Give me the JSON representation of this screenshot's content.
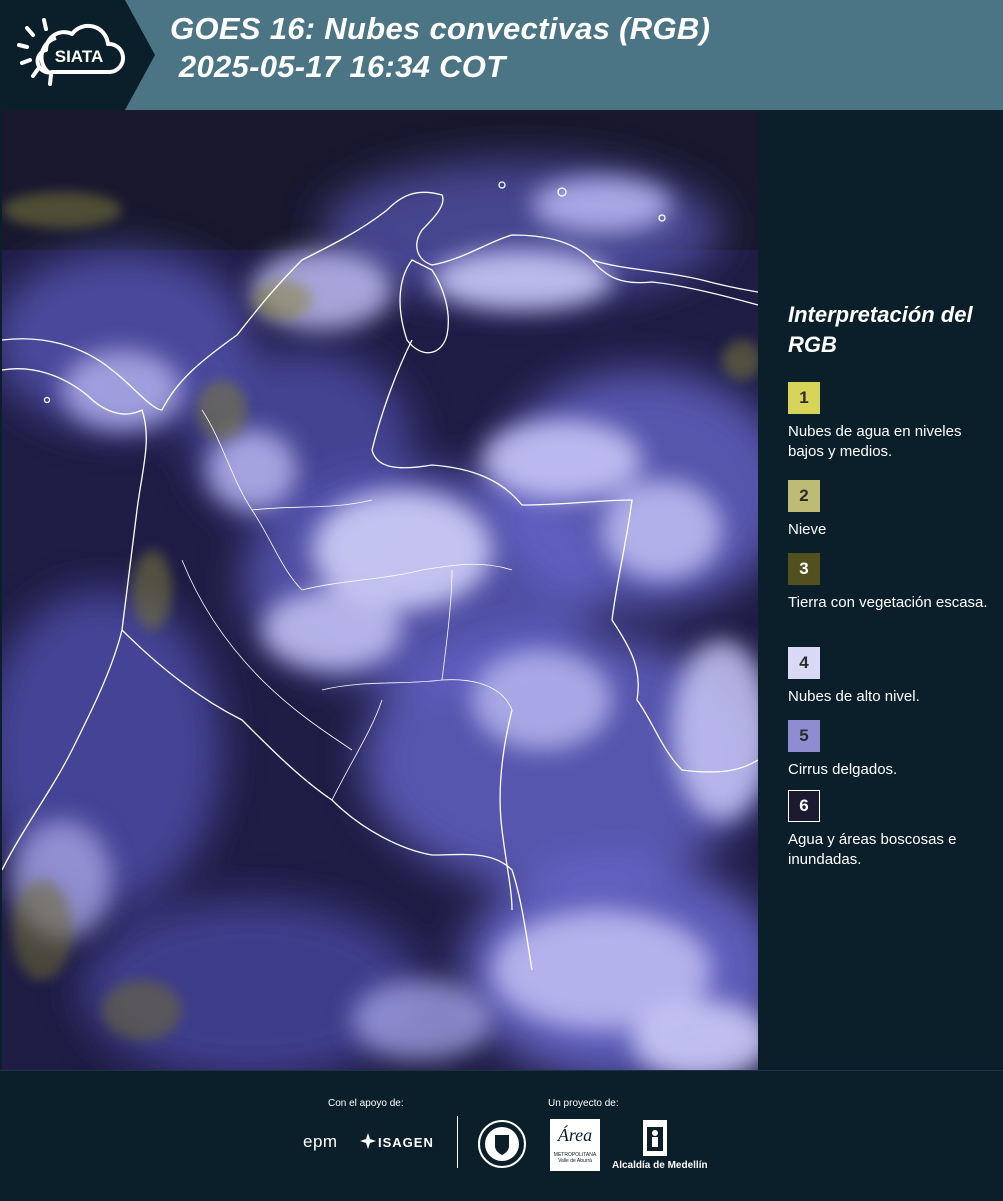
{
  "header": {
    "logo_text": "SIATA",
    "title_line1": "GOES 16: Nubes convectivas (RGB)",
    "title_line2": " 2025-05-17 16:34 COT"
  },
  "legend": {
    "title": "Interpretación del RGB",
    "items": [
      {
        "number": "1",
        "label": "Nubes de agua en niveles bajos y medios.",
        "color": "#d8d45a"
      },
      {
        "number": "2",
        "label": "Nieve",
        "color": "#bdbb74"
      },
      {
        "number": "3",
        "label": "Tierra con vegetación escasa.",
        "color": "#52501e"
      },
      {
        "number": "4",
        "label": "Nubes de alto nivel.",
        "color": "#d9d8f5"
      },
      {
        "number": "5",
        "label": "Cirrus delgados.",
        "color": "#8f8dd1"
      },
      {
        "number": "6",
        "label": "Agua y áreas boscosas e inundadas.",
        "color": "#1c1a30"
      }
    ]
  },
  "footer": {
    "support_label": "Con el apoyo de:",
    "project_label": "Un proyecto de:",
    "sponsors": [
      "epm",
      "ISAGEN"
    ],
    "partners": [
      "Área Metropolitana Valle de Aburrá",
      "Alcaldía de Medellín"
    ],
    "area_logo_text": "Área",
    "area_logo_subtext": "METROPOLITANA",
    "area_logo_subtext2": "Valle de Aburrá",
    "alcaldia_label": "Alcaldía de Medellín"
  },
  "colors": {
    "header_bg": "#4b7585",
    "panel_bg": "#0b1f2b",
    "map_base": "#1f1d45",
    "cloud_high": "#c9c8f7",
    "cloud_mid": "#6f6fd8"
  },
  "icons": [
    "sun-cloud-logo-icon",
    "medellin-seal-icon",
    "alcaldia-building-icon",
    "isagen-star-icon"
  ]
}
